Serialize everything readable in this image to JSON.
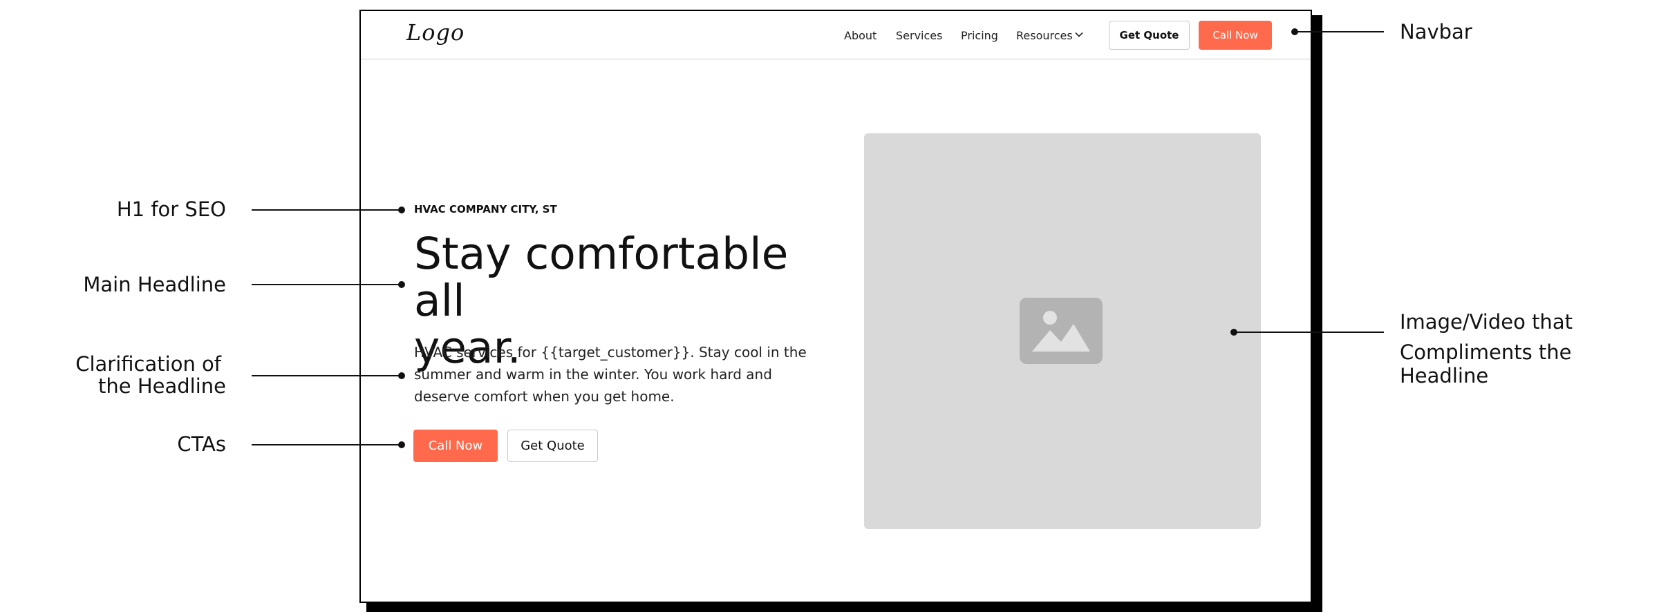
{
  "navbar": {
    "logo": "Logo",
    "links": [
      "About",
      "Services",
      "Pricing",
      "Resources"
    ],
    "get_quote": "Get Quote",
    "call_now": "Call Now"
  },
  "hero": {
    "eyebrow": "HVAC COMPANY CITY, ST",
    "headline_line1": "Stay comfortable all",
    "headline_line2": "year.",
    "subtext": "HVAC services for {{target_customer}}. Stay cool in the summer and warm in the winter. You work hard and deserve comfort when you get home.",
    "cta_primary": "Call Now",
    "cta_secondary": "Get Quote"
  },
  "annotations": {
    "h1": "H1 for SEO",
    "main_headline": "Main Headline",
    "clarification_line1": "Clarification of",
    "clarification_line2": "the Headline",
    "ctas": "CTAs",
    "navbar": "Navbar",
    "image_line1": "Image/Video that",
    "image_line2": "Compliments the Headline"
  },
  "colors": {
    "accent": "#ff6a4d",
    "placeholder": "#d9d9d9",
    "placeholder_icon": "#b3b3b3"
  }
}
